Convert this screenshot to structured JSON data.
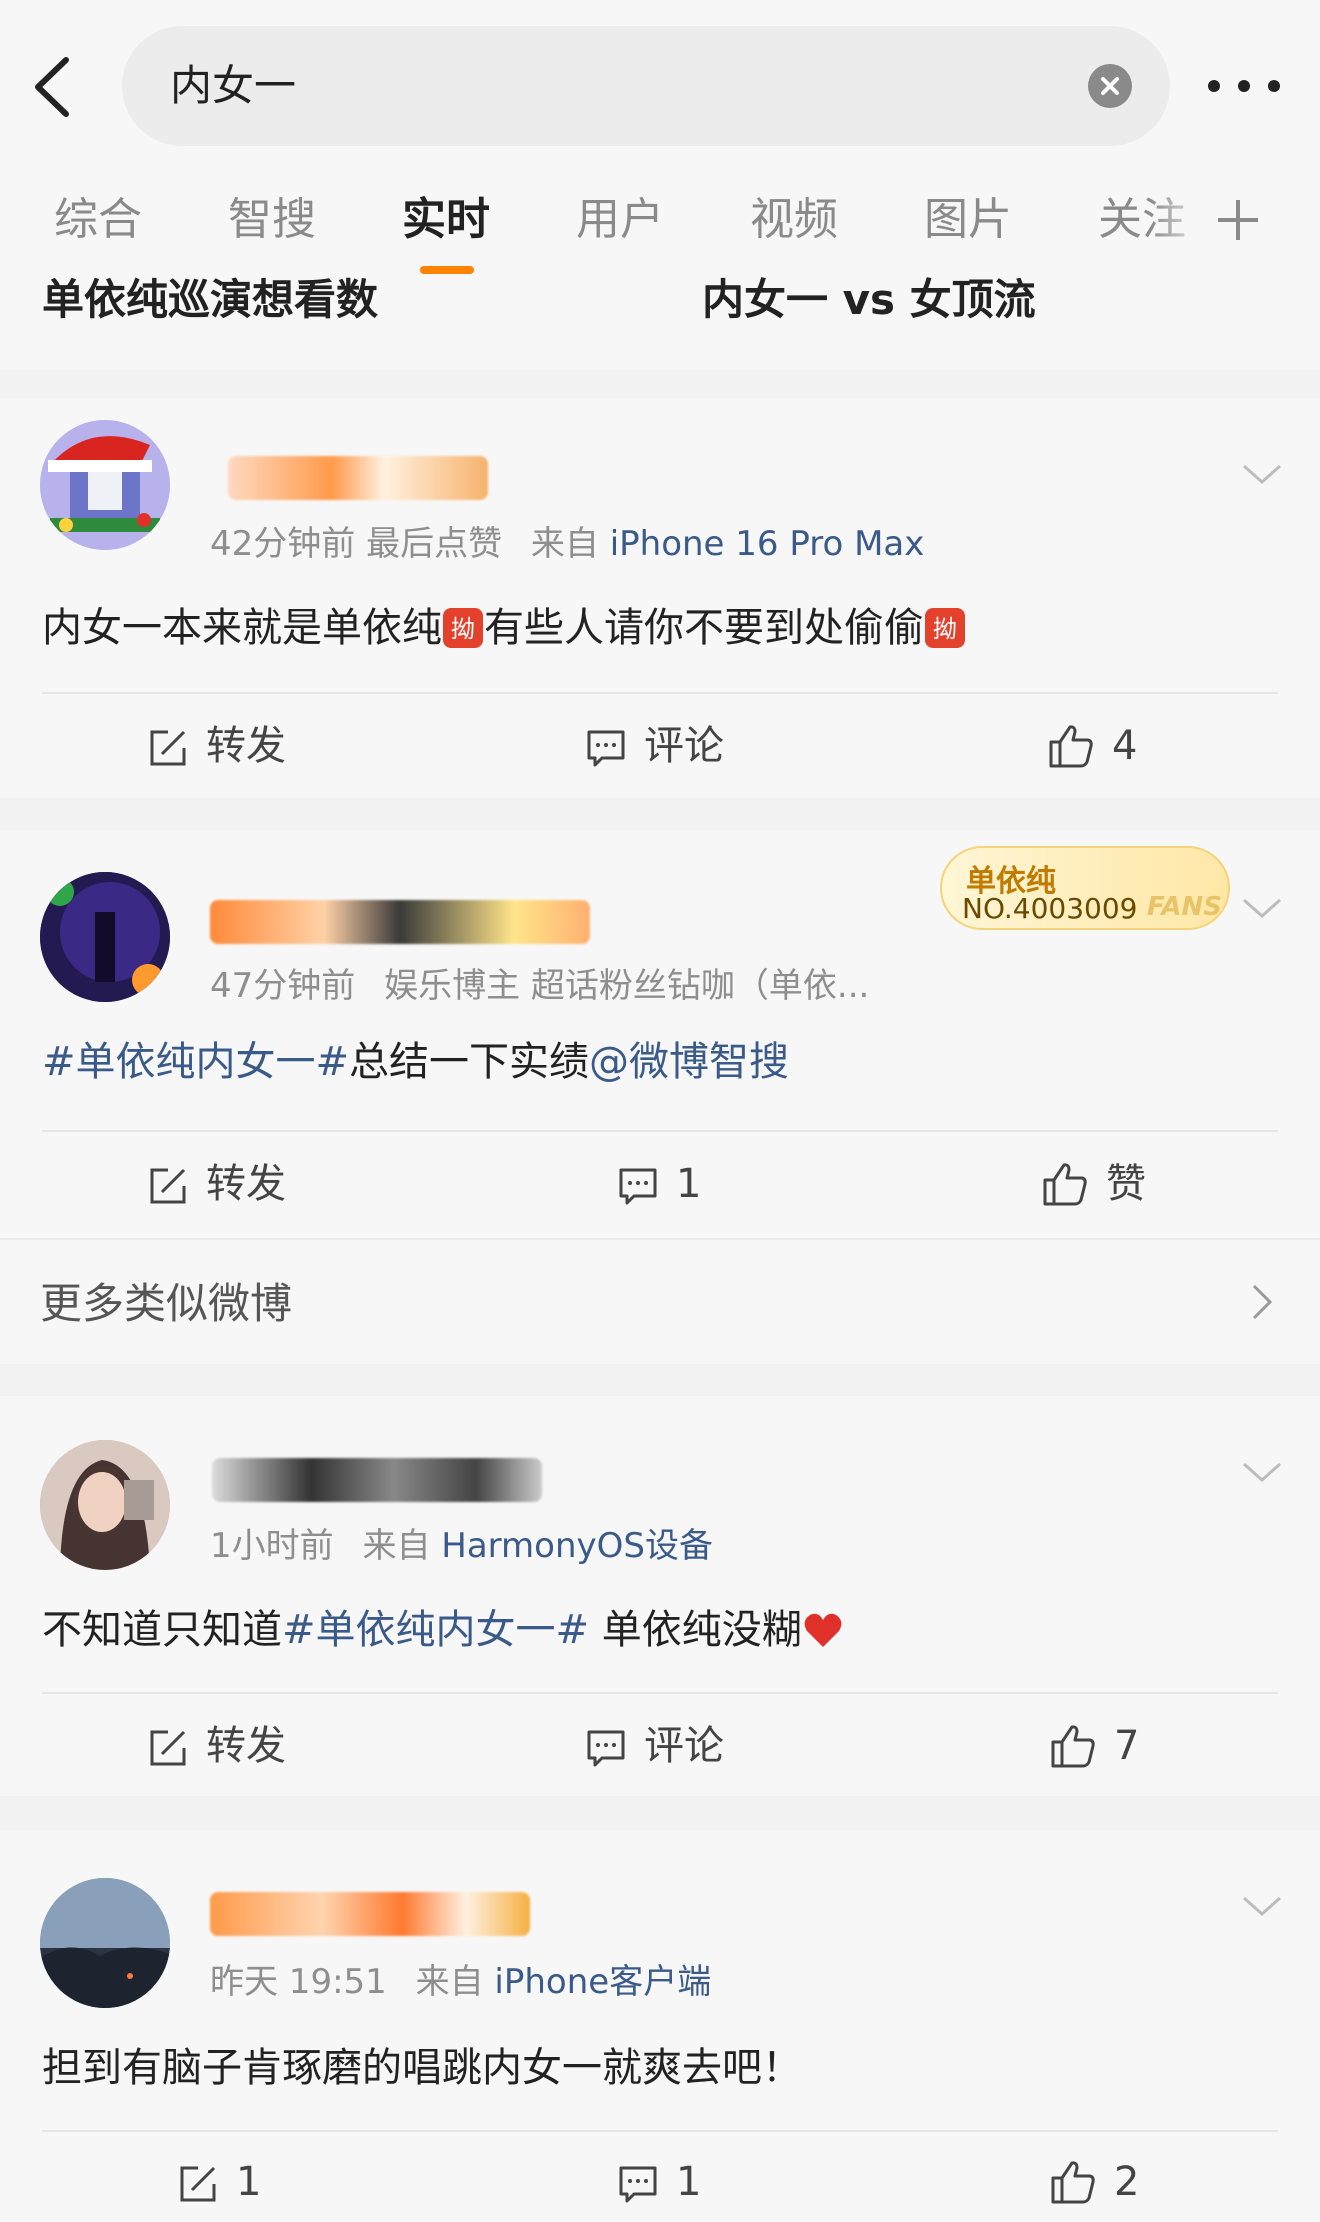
{
  "search": {
    "query": "内女一"
  },
  "tabs": [
    {
      "label": "综合"
    },
    {
      "label": "智搜"
    },
    {
      "label": "实时"
    },
    {
      "label": "用户"
    },
    {
      "label": "视频"
    },
    {
      "label": "图片"
    },
    {
      "label": "关注"
    }
  ],
  "ticker": {
    "left": "单依纯巡演想看数",
    "right": "内女一 vs 女顶流"
  },
  "colors": {
    "accent": "#ff8200",
    "link": "#3a5a8a",
    "like_heart": "#e0302a"
  },
  "posts": [
    {
      "meta_time": "42分钟前 最后点赞",
      "meta_from": "来自",
      "meta_source": "iPhone 16 Pro Max",
      "text_a": "内女一本来就是单依纯",
      "text_b": "有些人请你不要到处偷偷",
      "emoji": "拗-emoji",
      "actions": {
        "repost": "转发",
        "comment": "评论",
        "like": "4"
      }
    },
    {
      "meta_time": "47分钟前",
      "meta_extra": "娱乐博主 超话粉丝钻咖（单依...",
      "fans_badge": {
        "name": "单依纯",
        "number": "NO.4003009",
        "word": "FANS"
      },
      "topic": "#单依纯内女一#",
      "text": "总结一下实绩",
      "mention": "@微博智搜",
      "actions": {
        "repost": "转发",
        "comment": "1",
        "like": "赞"
      }
    },
    {
      "meta_time": "1小时前",
      "meta_from": "来自",
      "meta_source": "HarmonyOS设备",
      "text_a": "不知道只知道",
      "topic": "#单依纯内女一#",
      "text_b": " 单依纯没糊",
      "actions": {
        "repost": "转发",
        "comment": "评论",
        "like": "7"
      }
    },
    {
      "meta_time": "昨天 19:51",
      "meta_from": "来自",
      "meta_source": "iPhone客户端",
      "text": "担到有脑子肯琢磨的唱跳内女一就爽去吧！",
      "actions": {
        "repost": "1",
        "comment": "1",
        "like": "2"
      }
    }
  ],
  "more_similar": {
    "label": "更多类似微博"
  }
}
